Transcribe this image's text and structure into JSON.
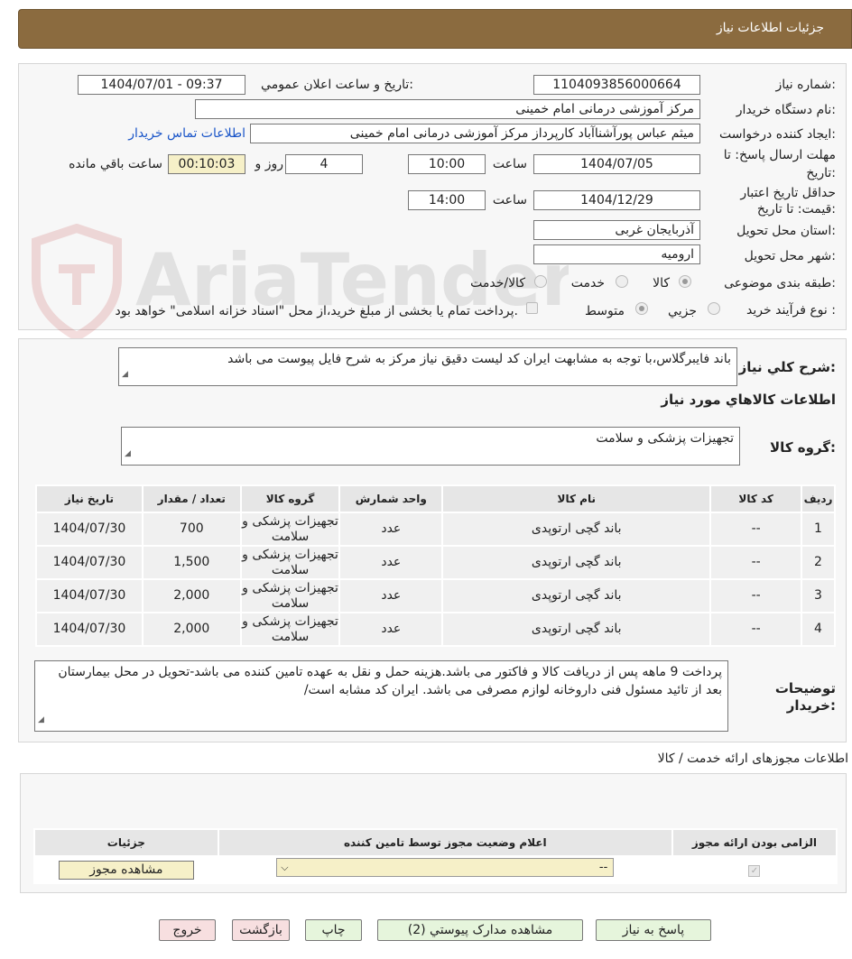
{
  "header": {
    "title": "جزئیات اطلاعات نیاز"
  },
  "form": {
    "need_number_label": "شماره نیاز:",
    "need_number": "1104093856000664",
    "announce_label": "تاریخ و ساعت اعلان عمومي:",
    "announce_value": "1404/07/01 - 09:37",
    "buyer_org_label": "نام دستگاه خريدار:",
    "buyer_org": "مرکز آموزشی درمانی امام خمینی",
    "creator_label": "ايجاد کننده درخواست:",
    "creator": "میثم عباس پورآشناآباد کارپرداز مرکز آموزشی درمانی امام خمینی",
    "contact_link": "اطلاعات تماس خريدار",
    "deadline_label_1": "مهلت ارسال پاسخ: تا",
    "deadline_label_2": "تاريخ:",
    "deadline_date": "1404/07/05",
    "time_label": "ساعت",
    "deadline_time": "10:00",
    "days_value": "4",
    "days_label": "روز و",
    "remaining_value": "00:10:03",
    "remaining_label": "ساعت باقي مانده",
    "validity_label_1": "حداقل تاريخ اعتبار",
    "validity_label_2": "قيمت: تا تاريخ:",
    "validity_date": "1404/12/29",
    "validity_time": "14:00",
    "province_label": "استان محل تحويل:",
    "province": "آذربايجان غربی",
    "city_label": "شهر محل تحويل:",
    "city": "ارومیه",
    "category_label": "طبقه بندی موضوعی:",
    "category_options": [
      "کالا",
      "خدمت",
      "کالا/خدمت"
    ],
    "process_label": "نوع فرآيند خريد :",
    "process_options": [
      "جزيي",
      "متوسط"
    ],
    "treasury_text": "پرداخت تمام يا بخشی از مبلغ خريد،از محل \"اسناد خزانه اسلامی\" خواهد بود."
  },
  "description": {
    "label": "شرح کلي نياز:",
    "text": "باند فایبرگلاس،با توجه به مشابهت ایران کد لیست دقیق نیاز مرکز به شرح فایل پیوست می باشد"
  },
  "goods": {
    "section_title": "اطلاعات کالاهاي مورد نياز",
    "group_label": "گروه کالا:",
    "group_value": "تجهیزات پزشکی و سلامت",
    "columns": [
      "رديف",
      "کد کالا",
      "نام کالا",
      "واحد شمارش",
      "گروه کالا",
      "تعداد / مقدار",
      "تاريخ نياز"
    ],
    "rows": [
      {
        "idx": "1",
        "code": "--",
        "name": "باند گچی ارتوپدی",
        "unit": "عدد",
        "group": "تجهیزات پزشکی و سلامت",
        "qty": "700",
        "date": "1404/07/30"
      },
      {
        "idx": "2",
        "code": "--",
        "name": "باند گچی ارتوپدی",
        "unit": "عدد",
        "group": "تجهیزات پزشکی و سلامت",
        "qty": "1,500",
        "date": "1404/07/30"
      },
      {
        "idx": "3",
        "code": "--",
        "name": "باند گچی ارتوپدی",
        "unit": "عدد",
        "group": "تجهیزات پزشکی و سلامت",
        "qty": "2,000",
        "date": "1404/07/30"
      },
      {
        "idx": "4",
        "code": "--",
        "name": "باند گچی ارتوپدی",
        "unit": "عدد",
        "group": "تجهیزات پزشکی و سلامت",
        "qty": "2,000",
        "date": "1404/07/30"
      }
    ]
  },
  "buyer_notes": {
    "label_1": "توضيحات",
    "label_2": "خريدار:",
    "text": "پرداخت  9  ماهه پس از دریافت کالا و فاکتور می باشد.هزینه حمل و نقل به عهده تامین کننده می باشد-تحویل در محل بیمارستان بعد از تائید مسئول فنی داروخانه لوازم مصرفی می باشد. ایران کد مشابه است/"
  },
  "licenses": {
    "section_title": "اطلاعات مجوزهای ارائه خدمت / کالا",
    "columns": [
      "الزامی بودن ارائه مجوز",
      "اعلام وضعيت مجوز توسط تامين کننده",
      "جزئيات"
    ],
    "select_value": "--",
    "view_button": "مشاهده مجوز"
  },
  "buttons": {
    "reply": "پاسخ به نياز",
    "docs": "مشاهده مدارک پيوستي (2)",
    "print": "چاپ",
    "back": "بازگشت",
    "exit": "خروج"
  },
  "watermark": {
    "text": "AriaTender.neT"
  }
}
